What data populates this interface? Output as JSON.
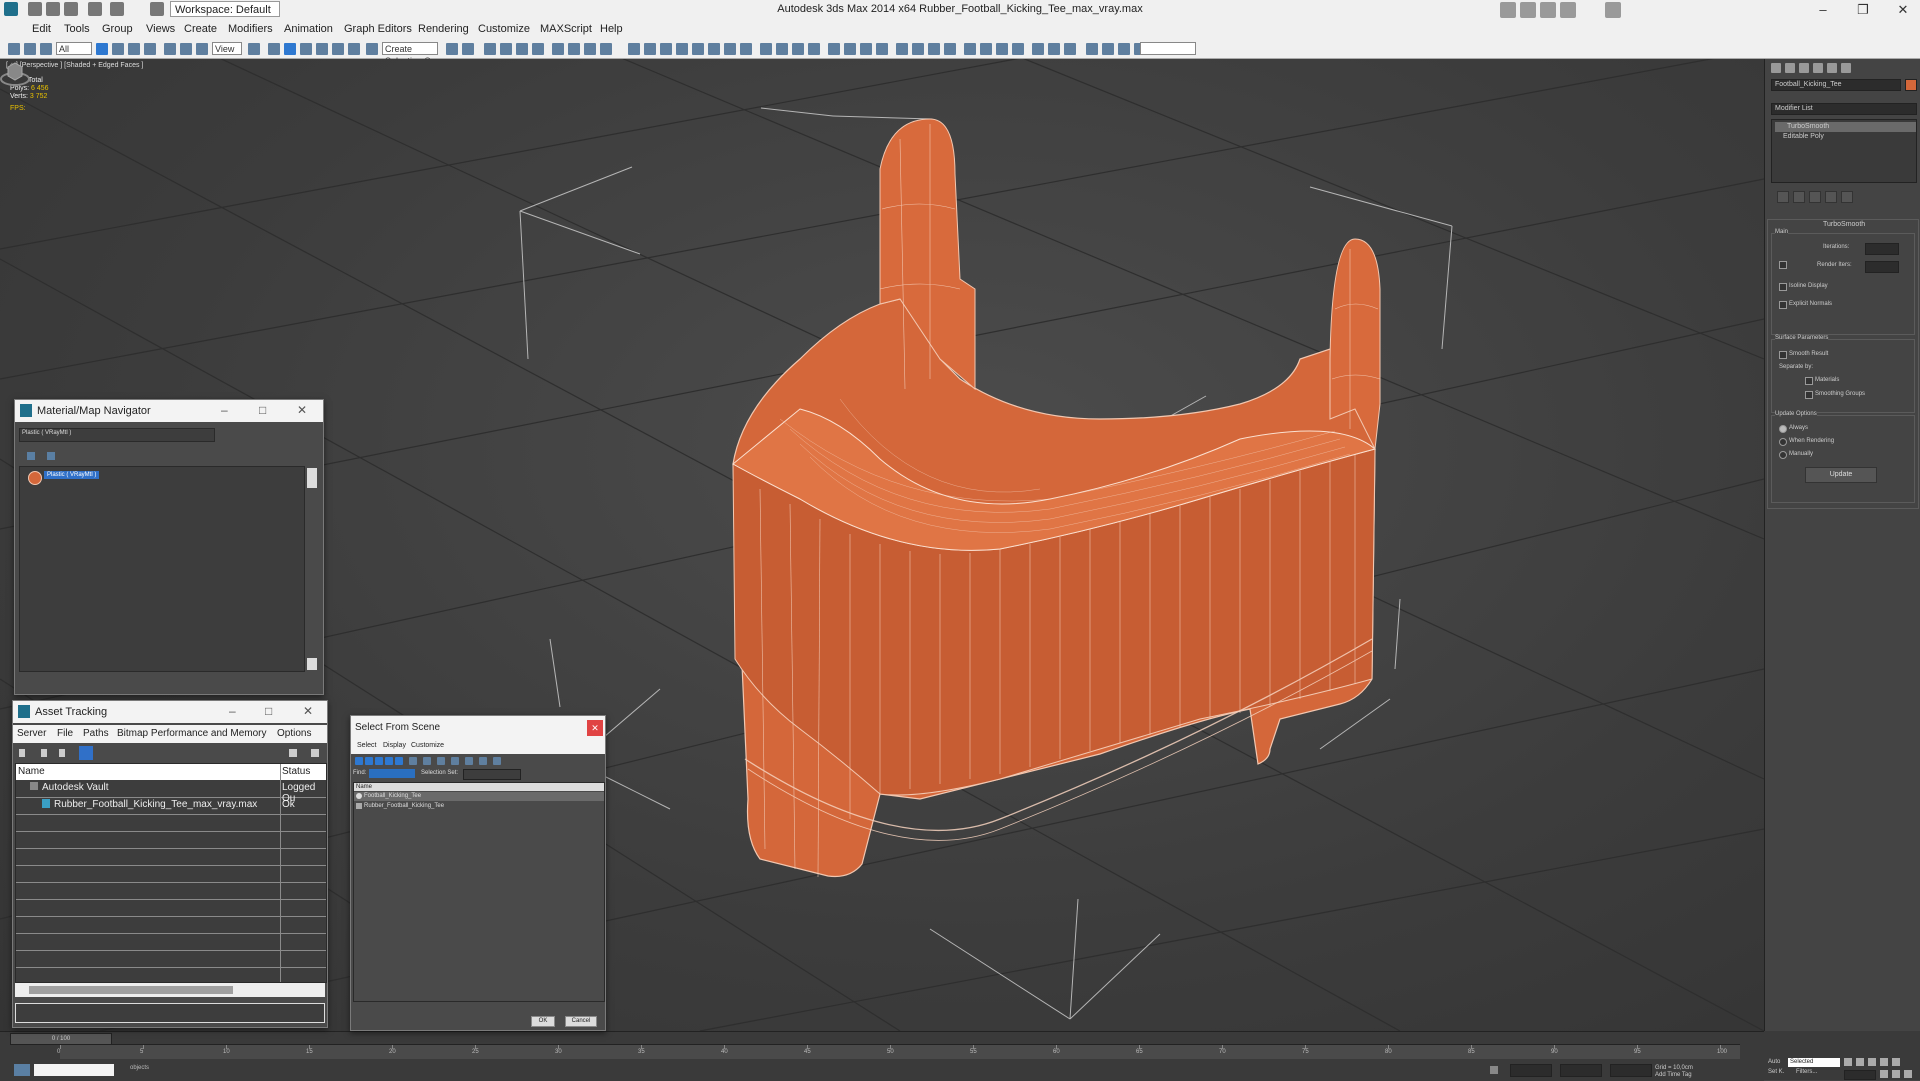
{
  "app": {
    "title": "Autodesk 3ds Max  2014 x64     Rubber_Football_Kicking_Tee_max_vray.max",
    "workspace": "Workspace: Default"
  },
  "menu": [
    "Edit",
    "Tools",
    "Group",
    "Views",
    "Create",
    "Modifiers",
    "Animation",
    "Graph Editors",
    "Rendering",
    "Customize",
    "MAXScript",
    "Help"
  ],
  "toolbar": {
    "filter_dropdown": "All",
    "view_dropdown": "View",
    "selection_set_dropdown": "Create Selection Se"
  },
  "viewport": {
    "label": "[ + ] [Perspective ] [Shaded + Edged Faces ]",
    "stats": {
      "total_label": "Total",
      "polys_label": "Polys:",
      "polys_value": "6 456",
      "verts_label": "Verts:",
      "verts_value": "3 752",
      "fps_label": "FPS:"
    },
    "object_color": "#d4673a"
  },
  "command_panel": {
    "object_name": "Football_Kicking_Tee",
    "modifier_list_label": "Modifier List",
    "stack": [
      "TurboSmooth",
      "Editable Poly"
    ],
    "rollout_title": "TurboSmooth",
    "main_label": "Main",
    "iterations_label": "Iterations:",
    "render_iters_label": "Render Iters:",
    "isoline_label": "Isoline Display",
    "explicit_normals_label": "Explicit Normals",
    "surface_params_label": "Surface Parameters",
    "smooth_result_label": "Smooth Result",
    "separate_by_label": "Separate by:",
    "materials_label": "Materials",
    "smoothing_groups_label": "Smoothing Groups",
    "update_options_label": "Update Options",
    "always_label": "Always",
    "when_rendering_label": "When Rendering",
    "manually_label": "Manually",
    "update_button": "Update"
  },
  "material_navigator": {
    "title": "Material/Map Navigator",
    "field": "Plastic  ( VRayMtl )",
    "tree_item": "Plastic  ( VRayMtl )"
  },
  "asset_tracking": {
    "title": "Asset Tracking",
    "menu": [
      "Server",
      "File",
      "Paths",
      "Bitmap Performance and Memory",
      "Options"
    ],
    "columns": [
      "Name",
      "Status"
    ],
    "rows": [
      {
        "name": "Autodesk Vault",
        "status": "Logged Ou"
      },
      {
        "name": "Rubber_Football_Kicking_Tee_max_vray.max",
        "status": "Ok"
      }
    ]
  },
  "select_from_scene": {
    "title": "Select From Scene",
    "menu": [
      "Select",
      "Display",
      "Customize"
    ],
    "find_label": "Find:",
    "selection_set_label": "Selection Set:",
    "column_name": "Name",
    "items": [
      "Football_Kicking_Tee",
      "Rubber_Football_Kicking_Tee"
    ],
    "ok": "OK",
    "cancel": "Cancel"
  },
  "timeline": {
    "slider": "0 / 100",
    "ticks": [
      "0",
      "5",
      "10",
      "15",
      "20",
      "25",
      "30",
      "35",
      "40",
      "45",
      "50",
      "55",
      "60",
      "65",
      "70",
      "75",
      "80",
      "85",
      "90",
      "95",
      "100"
    ]
  },
  "status": {
    "objects_text": "objects",
    "selected_label": "Selected",
    "grid_label": "Grid = 10,0cm",
    "add_time_tag": "Add Time Tag",
    "auto_label": "Auto",
    "set_k_label": "Set K.",
    "filters_label": "Filters..."
  }
}
